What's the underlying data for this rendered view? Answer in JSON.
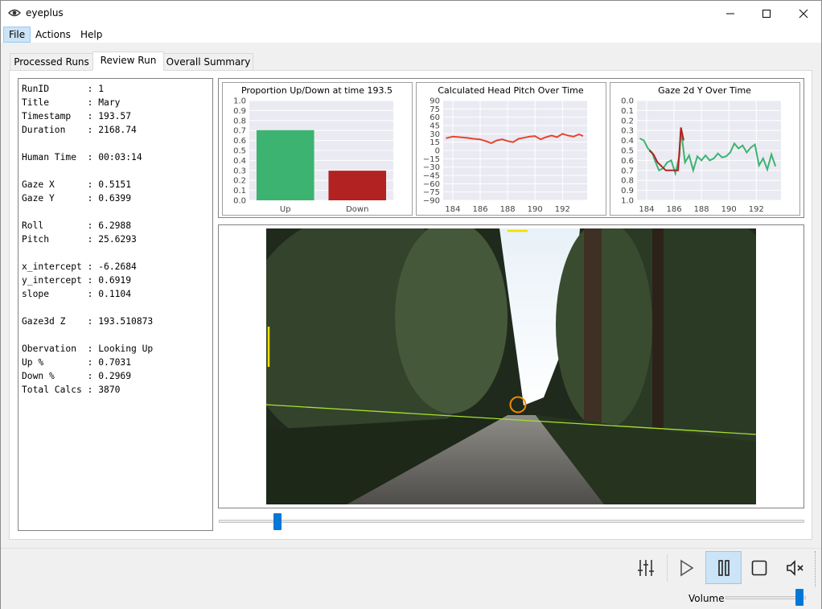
{
  "window": {
    "title": "eyeplus"
  },
  "menu": {
    "file": "File",
    "actions": "Actions",
    "help": "Help"
  },
  "tabs": [
    "Processed Runs",
    "Review Run",
    "Overall Summary"
  ],
  "info": {
    "lines": [
      "RunID       : 1",
      "Title       : Mary",
      "Timestamp   : 193.57",
      "Duration    : 2168.74",
      "",
      "Human Time  : 00:03:14",
      "",
      "Gaze X      : 0.5151",
      "Gaze Y      : 0.6399",
      "",
      "Roll        : 6.2988",
      "Pitch       : 25.6293",
      "",
      "x_intercept : -6.2684",
      "y_intercept : 0.6919",
      "slope       : 0.1104",
      "",
      "Gaze3d Z    : 193.510873",
      "",
      "Obervation  : Looking Up",
      "Up %        : 0.7031",
      "Down %      : 0.2969",
      "Total Calcs : 3870"
    ]
  },
  "chart_data": [
    {
      "type": "bar",
      "title": "Proportion Up/Down at time 193.5",
      "categories": [
        "Up",
        "Down"
      ],
      "values": [
        0.7031,
        0.2969
      ],
      "colors": [
        "#3cb371",
        "#b22222"
      ],
      "ylim": [
        0,
        1.0
      ],
      "yticks": [
        "0.0",
        "0.1",
        "0.2",
        "0.3",
        "0.4",
        "0.5",
        "0.6",
        "0.7",
        "0.8",
        "0.9",
        "1.0"
      ],
      "grid": true
    },
    {
      "type": "line",
      "title": "Calculated Head Pitch Over Time",
      "xlim": [
        183.3,
        193.8
      ],
      "ylim": [
        -90,
        90
      ],
      "xticks": [
        "184",
        "186",
        "188",
        "190",
        "192"
      ],
      "yticks": [
        "90",
        "75",
        "60",
        "45",
        "30",
        "15",
        "0",
        "−15",
        "−30",
        "−45",
        "−60",
        "−75",
        "−90"
      ],
      "series": [
        {
          "color": "#e8452c",
          "x": [
            183.5,
            184.0,
            184.5,
            185.0,
            185.5,
            186.0,
            186.5,
            186.8,
            187.2,
            187.6,
            188.0,
            188.4,
            188.8,
            189.2,
            189.6,
            190.0,
            190.4,
            190.8,
            191.2,
            191.6,
            192.0,
            192.4,
            192.8,
            193.2,
            193.5
          ],
          "y": [
            22,
            25,
            24,
            23,
            21,
            20,
            16,
            13,
            18,
            20,
            17,
            15,
            21,
            23,
            25,
            26,
            20,
            24,
            27,
            24,
            30,
            27,
            25,
            29,
            26
          ]
        }
      ],
      "grid": true
    },
    {
      "type": "line",
      "title": "Gaze 2d Y Over Time",
      "xlim": [
        183.3,
        193.8
      ],
      "ylim": [
        1.0,
        0.0
      ],
      "xticks": [
        "184",
        "186",
        "188",
        "190",
        "192"
      ],
      "yticks": [
        "0.0",
        "0.1",
        "0.2",
        "0.3",
        "0.4",
        "0.5",
        "0.6",
        "0.7",
        "0.8",
        "0.9",
        "1.0"
      ],
      "series": [
        {
          "color": "#3cb371",
          "x": [
            183.5,
            183.8,
            184.1,
            184.4,
            184.6,
            184.9,
            185.2,
            185.5,
            185.8,
            186.1,
            186.4,
            186.5,
            186.8,
            187.1,
            187.4,
            187.7,
            188.0,
            188.3,
            188.6,
            188.9,
            189.2,
            189.5,
            189.8,
            190.1,
            190.4,
            190.7,
            191.0,
            191.3,
            191.6,
            191.9,
            192.2,
            192.5,
            192.8,
            193.1,
            193.4
          ],
          "y": [
            0.38,
            0.4,
            0.48,
            0.52,
            0.6,
            0.7,
            0.68,
            0.62,
            0.6,
            0.73,
            0.55,
            0.29,
            0.62,
            0.55,
            0.7,
            0.56,
            0.6,
            0.55,
            0.6,
            0.58,
            0.53,
            0.57,
            0.56,
            0.52,
            0.43,
            0.48,
            0.45,
            0.52,
            0.47,
            0.44,
            0.65,
            0.58,
            0.69,
            0.54,
            0.66
          ]
        },
        {
          "color": "#b22222",
          "x": [
            184.2,
            184.5,
            184.8,
            185.1,
            185.4,
            186.3,
            186.5,
            186.7
          ],
          "y": [
            0.5,
            0.54,
            0.62,
            0.66,
            0.7,
            0.7,
            0.27,
            0.4
          ]
        }
      ],
      "grid": true
    }
  ],
  "video": {
    "overlay_colors": {
      "horizon": "#a6e22e",
      "gaze_ring": "#f28c00",
      "pitch_marker": "#f0e000"
    }
  },
  "controls": {
    "icons": [
      "settings-sliders-icon",
      "play-icon",
      "pause-icon",
      "stop-icon",
      "mute-icon"
    ],
    "volume_label": "Volume",
    "volume_level": 0.92,
    "timeline_position": 0.1
  },
  "colors": {
    "accent": "#0078d7"
  }
}
